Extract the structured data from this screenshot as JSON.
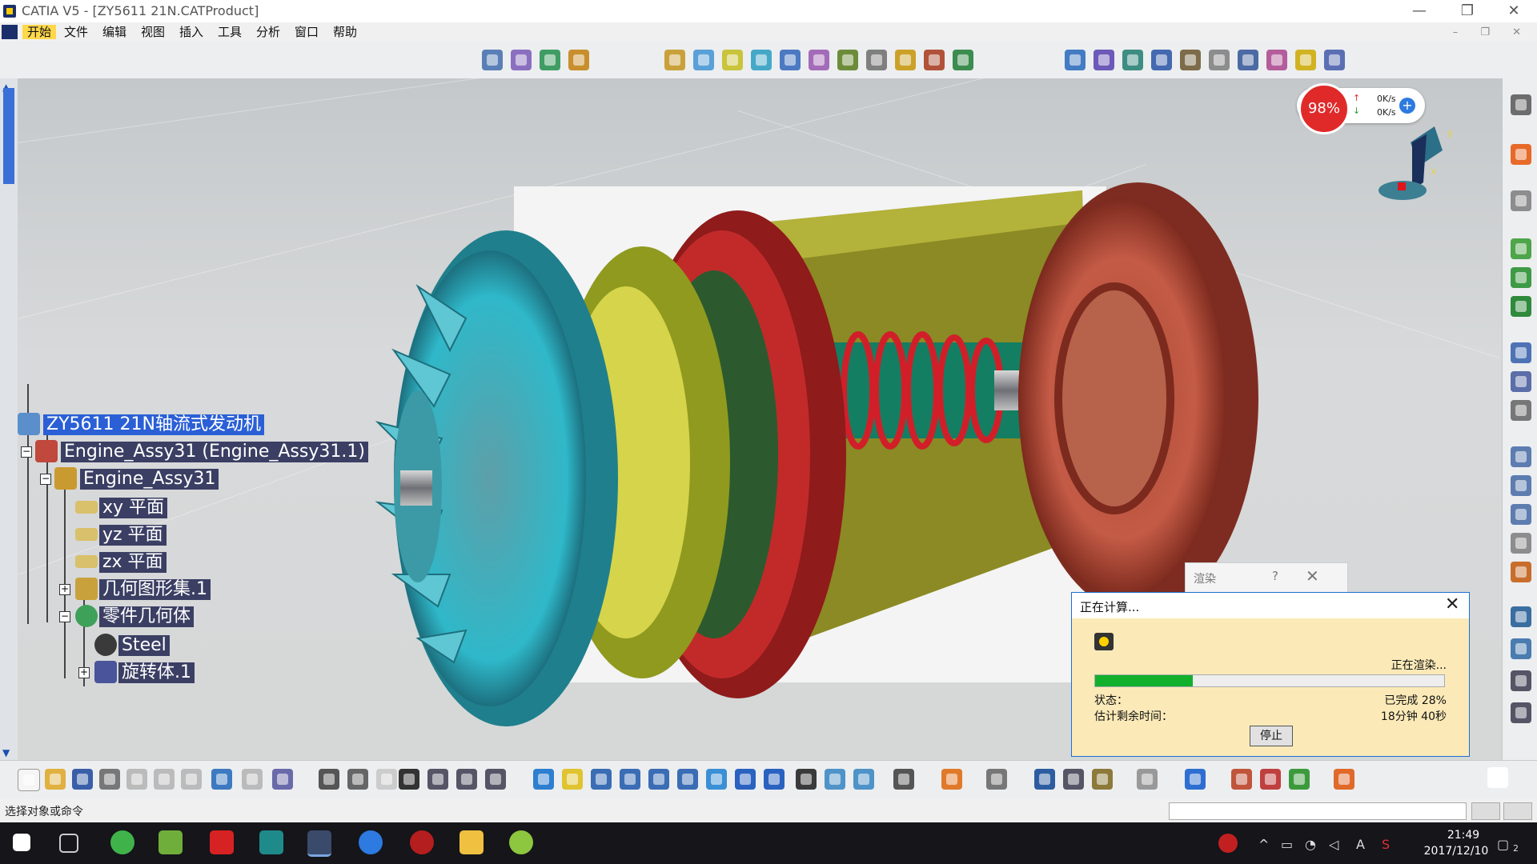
{
  "window": {
    "title": "CATIA V5 - [ZY5611 21N.CATProduct]",
    "minimize": "—",
    "restore": "❐",
    "close": "✕"
  },
  "menu": {
    "items": [
      "开始",
      "文件",
      "编辑",
      "视图",
      "插入",
      "工具",
      "分析",
      "窗口",
      "帮助"
    ],
    "active": "开始",
    "doc_buttons": "– ❐ ✕"
  },
  "tree": {
    "root": "ZY5611 21N轴流式发动机",
    "assembly_instance": "Engine_Assy31 (Engine_Assy31.1)",
    "assembly": "Engine_Assy31",
    "plane_xy": "xy 平面",
    "plane_yz": "yz 平面",
    "plane_zx": "zx 平面",
    "geom_set": "几何图形集.1",
    "body": "零件几何体",
    "material": "Steel",
    "revolve": "旋转体.1"
  },
  "speed_widget": {
    "percent": "98%",
    "up": "0K/s",
    "down": "0K/s",
    "plus": "+"
  },
  "render_dialog": {
    "title": "渲染",
    "help": "?",
    "close": "✕"
  },
  "calc_dialog": {
    "title": "正在计算...",
    "close": "✕",
    "rendering": "正在渲染...",
    "progress": 0.28,
    "status_label": "状态：",
    "status_value": "已完成 28%",
    "eta_label": "估计剩余时间：",
    "eta_value": "18分钟 40秒",
    "stop": "停止"
  },
  "status_bar": {
    "prompt": "选择对象或命令"
  },
  "taskbar": {
    "time": "21:49",
    "date": "2017/12/10",
    "ime": "A",
    "notification_count": "2"
  },
  "colors": {
    "tree_label_bg": "#3b3f63",
    "accent_blue": "#1d6fd1",
    "progress_green": "#12b02c",
    "menu_active": "#ffd84a",
    "speed_red": "#e02a2a"
  }
}
